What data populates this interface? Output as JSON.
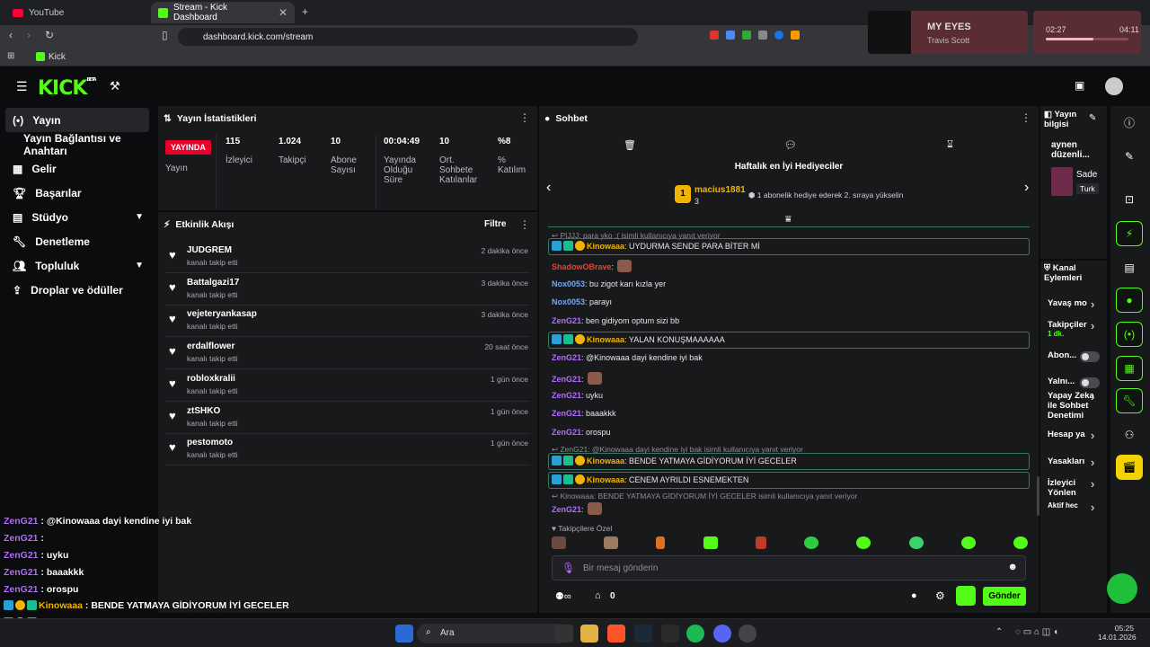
{
  "browser": {
    "tabs": [
      {
        "title": "YouTube",
        "active": false
      },
      {
        "title": "Stream - Kick Dashboard",
        "active": true
      }
    ],
    "url": "dashboard.kick.com/stream",
    "bookmark": "Kick",
    "media": {
      "title": "MY EYES",
      "artist": "Travis Scott",
      "elapsed": "02:27",
      "duration": "04:11"
    }
  },
  "kick": {
    "logo": "KICK",
    "beta": "BETA"
  },
  "nav": [
    {
      "label": "Yayın",
      "icon": "broadcast-icon"
    },
    {
      "label": "Yayın Bağlantısı ve Anahtarı",
      "icon": ""
    },
    {
      "label": "Gelir",
      "icon": "revenue-icon"
    },
    {
      "label": "Başarılar",
      "icon": "trophy-icon"
    },
    {
      "label": "Stüdyo",
      "icon": "studio-icon"
    },
    {
      "label": "Denetleme",
      "icon": "wrench-icon"
    },
    {
      "label": "Topluluk",
      "icon": "community-icon"
    },
    {
      "label": "Droplar ve ödüller",
      "icon": "drops-icon"
    }
  ],
  "stats": {
    "title": "Yayın İstatistikleri",
    "live_badge": "YAYINDA",
    "live_label": "Yayın",
    "items": [
      {
        "value": "115",
        "label": "İzleyici"
      },
      {
        "value": "1.024",
        "label": "Takipçi"
      },
      {
        "value": "10",
        "label": "Abone Sayısı"
      },
      {
        "value": "00:04:49",
        "label": "Yayında Olduğu Süre"
      },
      {
        "value": "10",
        "label": "Ort. Sohbete Katılanlar"
      },
      {
        "value": "%8",
        "label": "% Katılım"
      }
    ]
  },
  "activity": {
    "title": "Etkinlik Akışı",
    "filter": "Filtre",
    "events": [
      {
        "name": "JUDGREM",
        "action": "kanalı takip etti",
        "time": "2 dakika önce"
      },
      {
        "name": "Battalgazi17",
        "action": "kanalı takip etti",
        "time": "3 dakika önce"
      },
      {
        "name": "vejeteryankasap",
        "action": "kanalı takip etti",
        "time": "3 dakika önce"
      },
      {
        "name": "erdalflower",
        "action": "kanalı takip etti",
        "time": "20 saat önce"
      },
      {
        "name": "robloxkralii",
        "action": "kanalı takip etti",
        "time": "1 gün önce"
      },
      {
        "name": "ztSHKO",
        "action": "kanalı takip etti",
        "time": "1 gün önce"
      },
      {
        "name": "pestomoto",
        "action": "kanalı takip etti",
        "time": "1 gün önce"
      }
    ]
  },
  "chat": {
    "title": "Sohbet",
    "gifters_title": "Haftalık en İyi Hediyeciler",
    "top_gifter": "macius1881",
    "top_gifter_count": "3",
    "gifter_note": "1 abonelik hediye ederek 2. sıraya yükselin",
    "messages": [
      {
        "reply": "PIJJJ: para yko :( isimli kullanıcıya yanıt veriyor"
      },
      {
        "user": "Kinowaaa",
        "color": "#f2b400",
        "text": ": UYDURMA SENDE PARA BİTER Mİ",
        "hl": true
      },
      {
        "user": "ShadowOBrave",
        "color": "#e0453a",
        "text": ":",
        "emote": true
      },
      {
        "user": "Nox0053",
        "color": "#6ea8ff",
        "text": ": bu zigot karı kızla yer"
      },
      {
        "user": "Nox0053",
        "color": "#6ea8ff",
        "text": ": parayı"
      },
      {
        "user": "ZenG21",
        "color": "#b46cff",
        "text": ": ben gidiyom optum sizi bb"
      },
      {
        "user": "Kinowaaa",
        "color": "#f2b400",
        "text": ": YALAN KONUŞMAAAAAA",
        "hl": true
      },
      {
        "user": "ZenG21",
        "color": "#b46cff",
        "text": ": @Kinowaaa dayi kendine iyi bak"
      },
      {
        "user": "ZenG21",
        "color": "#b46cff",
        "text": ":",
        "emote": true
      },
      {
        "user": "ZenG21",
        "color": "#b46cff",
        "text": ": uyku"
      },
      {
        "user": "ZenG21",
        "color": "#b46cff",
        "text": ": baaakkk"
      },
      {
        "user": "ZenG21",
        "color": "#b46cff",
        "text": ": orospu"
      },
      {
        "reply": "ZenG21: @Kinowaaa dayi kendine iyi bak isimli kullanıcıya yanıt veriyor"
      },
      {
        "user": "Kinowaaa",
        "color": "#f2b400",
        "text": ": BENDE YATMAYA GİDİYORUM İYİ GECELER",
        "hl": true
      },
      {
        "user": "Kinowaaa",
        "color": "#f2b400",
        "text": ": CENEM AYRILDI ESNEMEKTEN",
        "hl": true
      },
      {
        "reply": "Kinowaaa: BENDE YATMAYA GİDİYORUM İYİ GECELER isimli kullanıcıya yanıt veriyor"
      },
      {
        "user": "ZenG21",
        "color": "#b46cff",
        "text": ":",
        "emote": true
      }
    ],
    "emotes_label": "Takipçilere Özel",
    "input_placeholder": "Bir mesaj gönderin",
    "points": "0",
    "send": "Gönder"
  },
  "info": {
    "title": "Yayın bilgisi",
    "stream_title": "aynen düzenli...",
    "category_name": "Sade",
    "tag": "Turk"
  },
  "channel": {
    "title": "Kanal Eylemleri",
    "actions": [
      {
        "label": "Yavaş mo"
      },
      {
        "label": "Takipçiler",
        "sub": "1 dk."
      },
      {
        "label": "Abon..."
      },
      {
        "label": "Yalnı..."
      },
      {
        "label": "Yapay Zeka ile Sohbet Denetimi"
      },
      {
        "label": "Hesap ya"
      },
      {
        "label": "Yasakları"
      },
      {
        "label": "İzleyici Yönlen"
      },
      {
        "label": "Aktif hec"
      }
    ]
  },
  "overlay": [
    {
      "user": "ZenG21",
      "text": " : @Kinowaaa dayi kendine iyi bak"
    },
    {
      "user": "ZenG21",
      "text": " :"
    },
    {
      "user": "ZenG21",
      "text": " : uyku"
    },
    {
      "user": "ZenG21",
      "text": " : baaakkk"
    },
    {
      "user": "ZenG21",
      "text": " : orospu"
    },
    {
      "user": "Kinowaaa",
      "text": " : BENDE YATMAYA GİDİYORUM İYİ GECELER"
    },
    {
      "user": "Kinowaaa",
      "text": " : CENEM AYRILDI ESNEMEKTEN"
    },
    {
      "user": "ZenG21",
      "text": " :"
    }
  ],
  "taskbar": {
    "search": "Ara",
    "time": "05:25",
    "date": "14.01.2026"
  }
}
